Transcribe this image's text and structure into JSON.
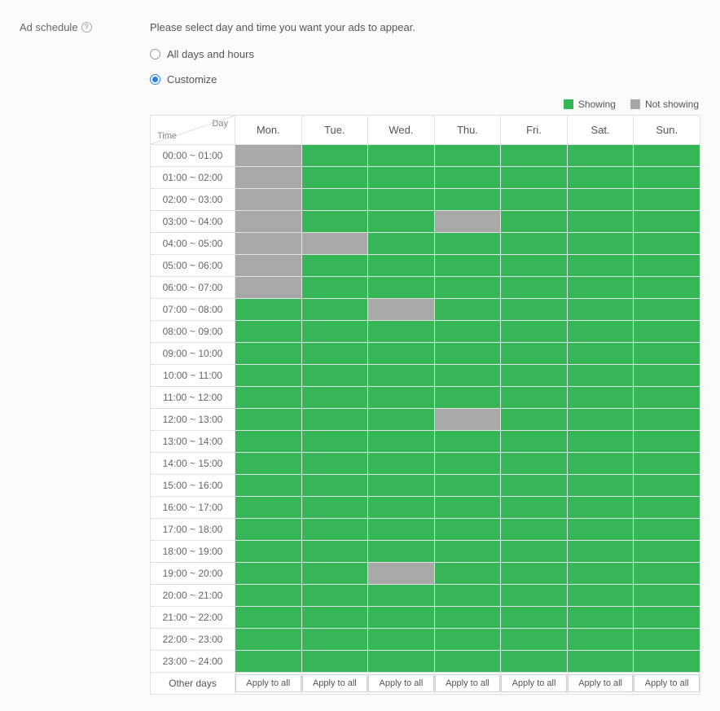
{
  "section_label": "Ad schedule",
  "intro_text": "Please select day and time you want your ads to appear.",
  "radios": {
    "all": {
      "label": "All days and hours",
      "checked": false
    },
    "customize": {
      "label": "Customize",
      "checked": true
    }
  },
  "legend": {
    "showing": "Showing",
    "not_showing": "Not showing"
  },
  "corner": {
    "day": "Day",
    "time": "Time"
  },
  "days": [
    "Mon.",
    "Tue.",
    "Wed.",
    "Thu.",
    "Fri.",
    "Sat.",
    "Sun."
  ],
  "time_slots": [
    "00:00 ~ 01:00",
    "01:00 ~ 02:00",
    "02:00 ~ 03:00",
    "03:00 ~ 04:00",
    "04:00 ~ 05:00",
    "05:00 ~ 06:00",
    "06:00 ~ 07:00",
    "07:00 ~ 08:00",
    "08:00 ~ 09:00",
    "09:00 ~ 10:00",
    "10:00 ~ 11:00",
    "11:00 ~ 12:00",
    "12:00 ~ 13:00",
    "13:00 ~ 14:00",
    "14:00 ~ 15:00",
    "15:00 ~ 16:00",
    "16:00 ~ 17:00",
    "17:00 ~ 18:00",
    "18:00 ~ 19:00",
    "19:00 ~ 20:00",
    "20:00 ~ 21:00",
    "21:00 ~ 22:00",
    "22:00 ~ 23:00",
    "23:00 ~ 24:00"
  ],
  "grid": [
    [
      0,
      1,
      1,
      1,
      1,
      1,
      1
    ],
    [
      0,
      1,
      1,
      1,
      1,
      1,
      1
    ],
    [
      0,
      1,
      1,
      1,
      1,
      1,
      1
    ],
    [
      0,
      1,
      1,
      0,
      1,
      1,
      1
    ],
    [
      0,
      0,
      1,
      1,
      1,
      1,
      1
    ],
    [
      0,
      1,
      1,
      1,
      1,
      1,
      1
    ],
    [
      0,
      1,
      1,
      1,
      1,
      1,
      1
    ],
    [
      1,
      1,
      0,
      1,
      1,
      1,
      1
    ],
    [
      1,
      1,
      1,
      1,
      1,
      1,
      1
    ],
    [
      1,
      1,
      1,
      1,
      1,
      1,
      1
    ],
    [
      1,
      1,
      1,
      1,
      1,
      1,
      1
    ],
    [
      1,
      1,
      1,
      1,
      1,
      1,
      1
    ],
    [
      1,
      1,
      1,
      0,
      1,
      1,
      1
    ],
    [
      1,
      1,
      1,
      1,
      1,
      1,
      1
    ],
    [
      1,
      1,
      1,
      1,
      1,
      1,
      1
    ],
    [
      1,
      1,
      1,
      1,
      1,
      1,
      1
    ],
    [
      1,
      1,
      1,
      1,
      1,
      1,
      1
    ],
    [
      1,
      1,
      1,
      1,
      1,
      1,
      1
    ],
    [
      1,
      1,
      1,
      1,
      1,
      1,
      1
    ],
    [
      1,
      1,
      0,
      1,
      1,
      1,
      1
    ],
    [
      1,
      1,
      1,
      1,
      1,
      1,
      1
    ],
    [
      1,
      1,
      1,
      1,
      1,
      1,
      1
    ],
    [
      1,
      1,
      1,
      1,
      1,
      1,
      1
    ],
    [
      1,
      1,
      1,
      1,
      1,
      1,
      1
    ]
  ],
  "other_days_label": "Other days",
  "apply_button_label": "Apply to all",
  "colors": {
    "showing": "#37b657",
    "not_showing": "#a8a8a8",
    "accent": "#2b7de9"
  }
}
